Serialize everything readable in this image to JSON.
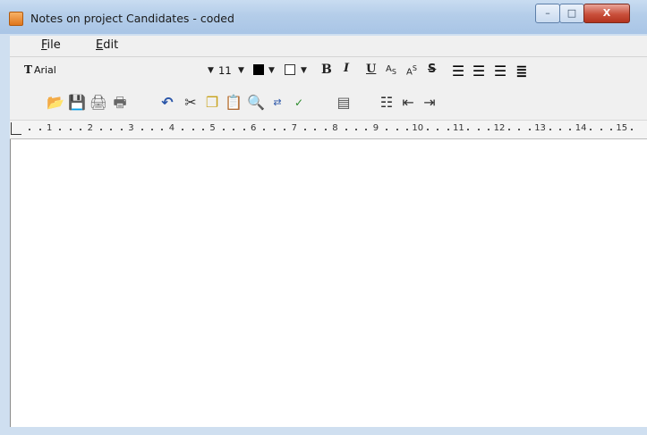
{
  "window": {
    "title": "Notes on project Candidates - coded",
    "controls": {
      "minimize": "–",
      "maximize": "□",
      "close": "X"
    }
  },
  "menu": {
    "file_u": "F",
    "file_rest": "ile",
    "edit_u": "E",
    "edit_rest": "dit"
  },
  "format_toolbar": {
    "font_name": "Arial",
    "font_icon": "T",
    "font_size": "11",
    "text_color": "#000000",
    "highlight_color": "#ffffff",
    "bold": "B",
    "italic": "I",
    "underline": "U",
    "subscript": "A",
    "subscript_mark": "S",
    "superscript": "A",
    "superscript_mark": "S",
    "strikethrough": "S"
  },
  "icons": [
    "open-folder-icon",
    "save-file-icon",
    "print-icon",
    "print-preview-icon",
    "undo-icon",
    "cut-icon",
    "copy-icon",
    "paste-icon",
    "find-icon",
    "replace-icon",
    "spell-check-icon",
    "properties-icon",
    "bullet-list-icon",
    "outdent-icon",
    "indent-icon",
    "align-left-icon",
    "align-center-icon",
    "align-right-icon",
    "justify-icon"
  ],
  "ruler": {
    "numbers": [
      "1",
      "2",
      "3",
      "4",
      "5",
      "6",
      "7",
      "8",
      "9",
      "10",
      "11",
      "12",
      "13",
      "14",
      "15"
    ]
  },
  "editor": {
    "content": ""
  }
}
